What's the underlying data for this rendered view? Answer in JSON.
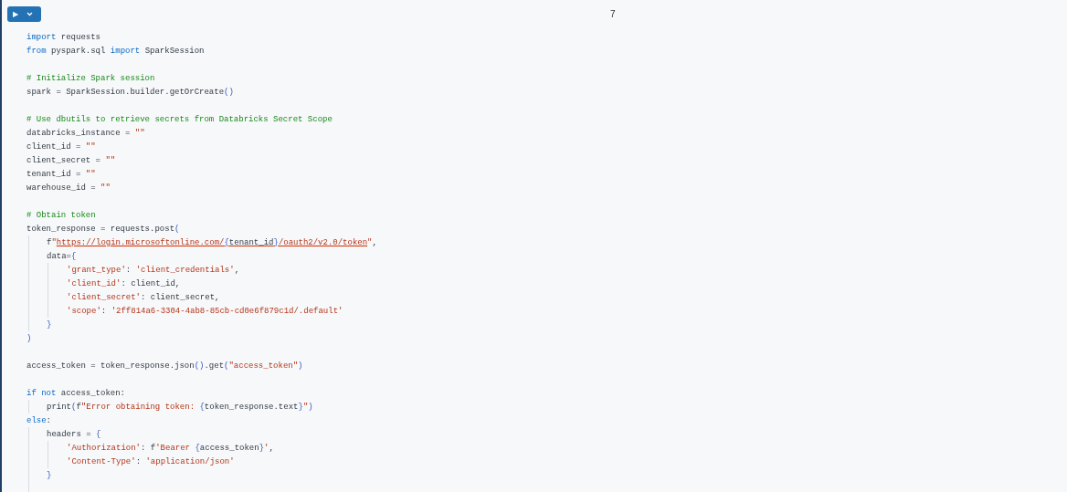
{
  "cell": {
    "run_button": {
      "icon": "▶"
    },
    "cell_number": "7",
    "lines": [
      {
        "kind": "code",
        "tokens": [
          {
            "kind": "keyword",
            "text": "import"
          },
          {
            "kind": "plain",
            "text": " requests"
          }
        ]
      },
      {
        "kind": "code",
        "tokens": [
          {
            "kind": "keyword",
            "text": "from"
          },
          {
            "kind": "plain",
            "text": " pyspark.sql "
          },
          {
            "kind": "keyword",
            "text": "import"
          },
          {
            "kind": "plain",
            "text": " SparkSession"
          }
        ]
      },
      {
        "kind": "blank"
      },
      {
        "kind": "code",
        "tokens": [
          {
            "kind": "comment",
            "text": "# Initialize Spark session"
          }
        ]
      },
      {
        "kind": "code",
        "tokens": [
          {
            "kind": "plain",
            "text": "spark = SparkSession.builder.getOrCreate"
          },
          {
            "kind": "bracket",
            "text": "()"
          }
        ]
      },
      {
        "kind": "blank"
      },
      {
        "kind": "code",
        "tokens": [
          {
            "kind": "comment",
            "text": "# Use dbutils to retrieve secrets from Databricks Secret Scope"
          }
        ]
      },
      {
        "kind": "code",
        "tokens": [
          {
            "kind": "plain",
            "text": "databricks_instance = "
          },
          {
            "kind": "string",
            "text": "\"\""
          }
        ]
      },
      {
        "kind": "code",
        "tokens": [
          {
            "kind": "plain",
            "text": "client_id = "
          },
          {
            "kind": "string",
            "text": "\"\""
          }
        ]
      },
      {
        "kind": "code",
        "tokens": [
          {
            "kind": "plain",
            "text": "client_secret = "
          },
          {
            "kind": "string",
            "text": "\"\""
          }
        ]
      },
      {
        "kind": "code",
        "tokens": [
          {
            "kind": "plain",
            "text": "tenant_id = "
          },
          {
            "kind": "string",
            "text": "\"\""
          }
        ]
      },
      {
        "kind": "code",
        "tokens": [
          {
            "kind": "plain",
            "text": "warehouse_id = "
          },
          {
            "kind": "string",
            "text": "\"\""
          }
        ]
      },
      {
        "kind": "blank"
      },
      {
        "kind": "code",
        "tokens": [
          {
            "kind": "comment",
            "text": "# Obtain token"
          }
        ]
      },
      {
        "kind": "code",
        "tokens": [
          {
            "kind": "plain",
            "text": "token_response = requests.post"
          },
          {
            "kind": "bracket",
            "text": "("
          }
        ],
        "children": [
          {
            "kind": "code",
            "tokens": [
              {
                "kind": "plain",
                "text": "f"
              },
              {
                "kind": "string",
                "text": "\""
              },
              {
                "kind": "string",
                "text": "https://login.microsoftonline.com/",
                "underlined": true
              },
              {
                "kind": "bracket",
                "text": "{",
                "underlined": true
              },
              {
                "kind": "plain",
                "text": "tenant_id",
                "underlined": true
              },
              {
                "kind": "bracket",
                "text": "}",
                "underlined": true
              },
              {
                "kind": "string",
                "text": "/oauth2/v2.0/token",
                "underlined": true
              },
              {
                "kind": "string",
                "text": "\""
              },
              {
                "kind": "plain",
                "text": ","
              }
            ]
          },
          {
            "kind": "code",
            "tokens": [
              {
                "kind": "plain",
                "text": "data="
              },
              {
                "kind": "bracket",
                "text": "{"
              }
            ],
            "children": [
              {
                "kind": "code",
                "tokens": [
                  {
                    "kind": "string",
                    "text": "'grant_type'"
                  },
                  {
                    "kind": "plain",
                    "text": ": "
                  },
                  {
                    "kind": "string",
                    "text": "'client_credentials'"
                  },
                  {
                    "kind": "plain",
                    "text": ","
                  }
                ]
              },
              {
                "kind": "code",
                "tokens": [
                  {
                    "kind": "string",
                    "text": "'client_id'"
                  },
                  {
                    "kind": "plain",
                    "text": ": client_id,"
                  }
                ]
              },
              {
                "kind": "code",
                "tokens": [
                  {
                    "kind": "string",
                    "text": "'client_secret'"
                  },
                  {
                    "kind": "plain",
                    "text": ": client_secret,"
                  }
                ]
              },
              {
                "kind": "code",
                "tokens": [
                  {
                    "kind": "string",
                    "text": "'scope'"
                  },
                  {
                    "kind": "plain",
                    "text": ": "
                  },
                  {
                    "kind": "string",
                    "text": "'2ff814a6-3304-4ab8-85cb-cd0e6f879c1d/.default'"
                  }
                ]
              }
            ]
          },
          {
            "kind": "code",
            "tokens": [
              {
                "kind": "bracket",
                "text": "}"
              }
            ]
          }
        ]
      },
      {
        "kind": "code",
        "tokens": [
          {
            "kind": "bracket",
            "text": ")"
          }
        ]
      },
      {
        "kind": "blank"
      },
      {
        "kind": "code",
        "tokens": [
          {
            "kind": "plain",
            "text": "access_token = token_response.json"
          },
          {
            "kind": "bracket",
            "text": "()"
          },
          {
            "kind": "plain",
            "text": ".get"
          },
          {
            "kind": "bracket",
            "text": "("
          },
          {
            "kind": "string",
            "text": "\"access_token\""
          },
          {
            "kind": "bracket",
            "text": ")"
          }
        ]
      },
      {
        "kind": "blank"
      },
      {
        "kind": "code",
        "tokens": [
          {
            "kind": "keyword",
            "text": "if not"
          },
          {
            "kind": "plain",
            "text": " access_token:"
          }
        ],
        "children": [
          {
            "kind": "code",
            "tokens": [
              {
                "kind": "plain",
                "text": "print"
              },
              {
                "kind": "bracket",
                "text": "("
              },
              {
                "kind": "plain",
                "text": "f"
              },
              {
                "kind": "string",
                "text": "\"Error obtaining token: "
              },
              {
                "kind": "bracket",
                "text": "{"
              },
              {
                "kind": "plain",
                "text": "token_response.text"
              },
              {
                "kind": "bracket",
                "text": "}"
              },
              {
                "kind": "string",
                "text": "\""
              },
              {
                "kind": "bracket",
                "text": ")"
              }
            ]
          }
        ]
      },
      {
        "kind": "code",
        "tokens": [
          {
            "kind": "keyword",
            "text": "else"
          },
          {
            "kind": "plain",
            "text": ":"
          }
        ],
        "children": [
          {
            "kind": "code",
            "tokens": [
              {
                "kind": "plain",
                "text": "headers = "
              },
              {
                "kind": "bracket",
                "text": "{"
              }
            ],
            "children": [
              {
                "kind": "code",
                "tokens": [
                  {
                    "kind": "string",
                    "text": "'Authorization'"
                  },
                  {
                    "kind": "plain",
                    "text": ": f"
                  },
                  {
                    "kind": "string",
                    "text": "'Bearer "
                  },
                  {
                    "kind": "bracket",
                    "text": "{"
                  },
                  {
                    "kind": "plain",
                    "text": "access_token"
                  },
                  {
                    "kind": "bracket",
                    "text": "}"
                  },
                  {
                    "kind": "string",
                    "text": "'"
                  },
                  {
                    "kind": "plain",
                    "text": ","
                  }
                ]
              },
              {
                "kind": "code",
                "tokens": [
                  {
                    "kind": "string",
                    "text": "'Content-Type'"
                  },
                  {
                    "kind": "plain",
                    "text": ": "
                  },
                  {
                    "kind": "string",
                    "text": "'application/json'"
                  }
                ]
              }
            ]
          },
          {
            "kind": "code",
            "tokens": [
              {
                "kind": "bracket",
                "text": "}"
              }
            ]
          },
          {
            "kind": "blank"
          }
        ]
      }
    ]
  }
}
